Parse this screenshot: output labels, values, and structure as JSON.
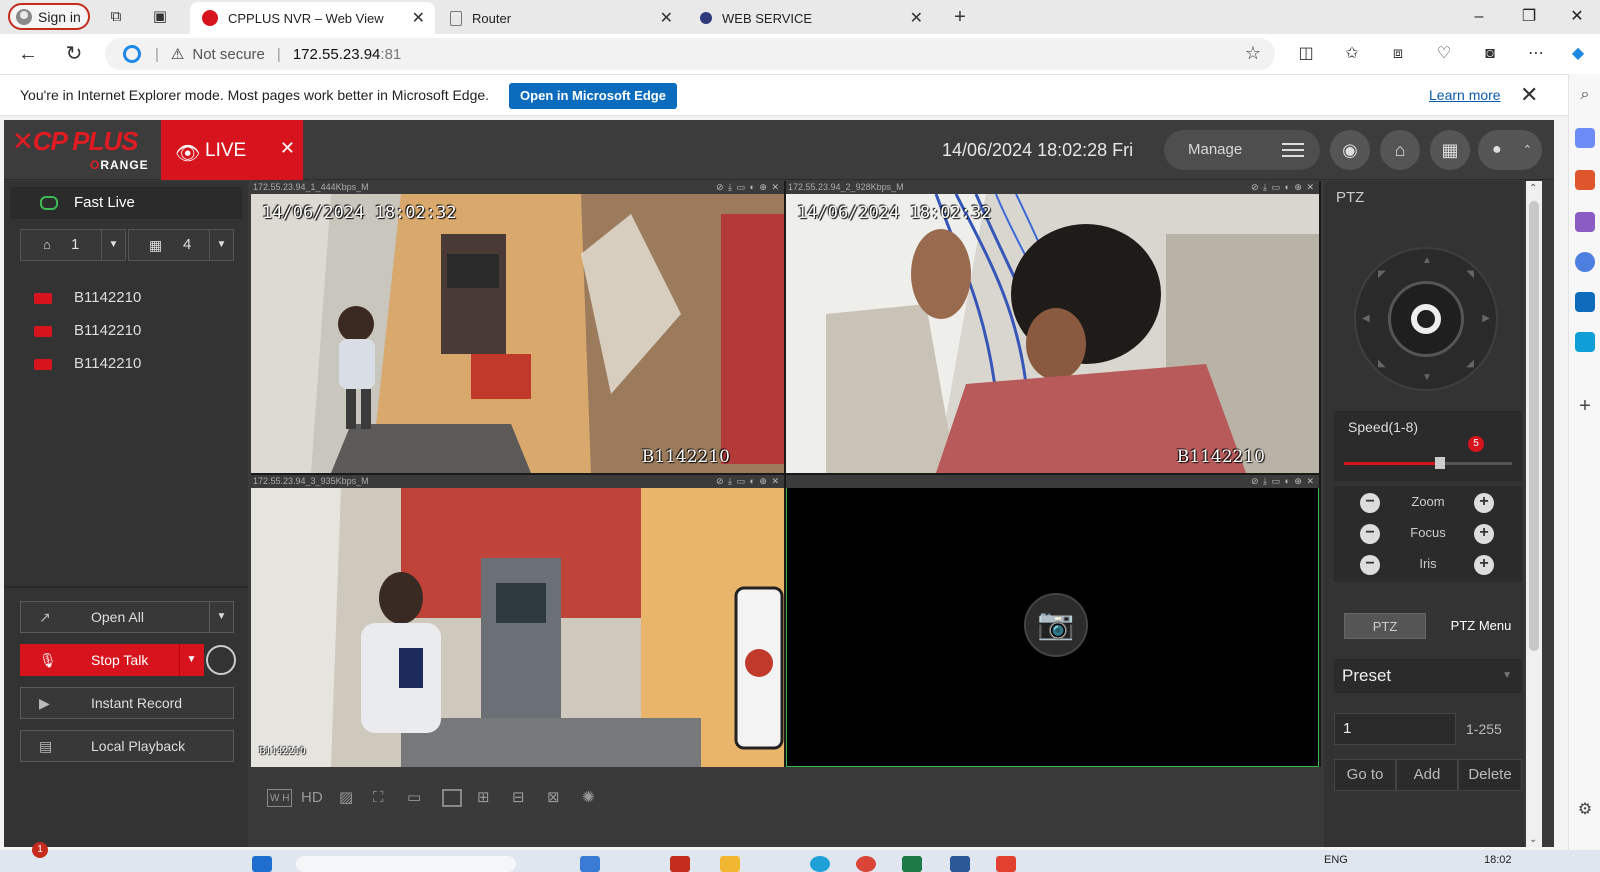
{
  "browser": {
    "signin_label": "Sign in",
    "tabs": [
      {
        "title": "CPPLUS NVR – Web View",
        "active": true
      },
      {
        "title": "Router",
        "active": false
      },
      {
        "title": "WEB SERVICE",
        "active": false
      }
    ],
    "new_tab_icon": "plus-icon",
    "address": {
      "not_secure": "Not secure",
      "host": "172.55.23.94",
      "port": ":81"
    },
    "ie_mode": {
      "message": "You're in Internet Explorer mode. Most pages work better in Microsoft Edge.",
      "open_button": "Open in Microsoft Edge",
      "learn_more": "Learn more"
    }
  },
  "nvr": {
    "live_tab": "LIVE",
    "datetime": "14/06/2024 18:02:28 Fri",
    "manage": "Manage",
    "left": {
      "fast_live": "Fast Live",
      "stream_select": "1",
      "layout_select": "4",
      "devices": [
        "B1142210",
        "B1142210",
        "B1142210"
      ],
      "open_all": "Open All",
      "stop_talk": "Stop Talk",
      "instant_record": "Instant Record",
      "local_playback": "Local Playback"
    },
    "cameras": [
      {
        "header": "172.55.23.94_1_444Kbps_M",
        "osd_time": "14/06/2024 18:02:32",
        "osd_name": "B1142210"
      },
      {
        "header": "172.55.23.94_2_928Kbps_M",
        "osd_time": "14/06/2024 18:02:32",
        "osd_name": "B1142210"
      },
      {
        "header": "172.55.23.94_3_935Kbps_M",
        "osd_time": "",
        "osd_name": "B1142210"
      },
      {
        "header": "",
        "osd_time": "",
        "osd_name": ""
      }
    ],
    "toolbar": {
      "hd": "HD",
      "wh": "W H"
    },
    "ptz": {
      "title": "PTZ",
      "speed_label": "Speed(1-8)",
      "speed_value": "5",
      "speed_fraction": 0.57,
      "zoom": "Zoom",
      "focus": "Focus",
      "iris": "Iris",
      "tab_ptz": "PTZ",
      "tab_menu": "PTZ Menu",
      "preset": "Preset",
      "preset_value": "1",
      "preset_range": "1-255",
      "goto": "Go to",
      "add": "Add",
      "delete": "Delete"
    }
  },
  "taskbar": {
    "notification_count": "1",
    "lang": "ENG",
    "time": "18:02"
  },
  "colors": {
    "brand_red": "#d7141e",
    "edge_blue": "#0b6cbd",
    "app_bg": "#3a3a3a"
  }
}
